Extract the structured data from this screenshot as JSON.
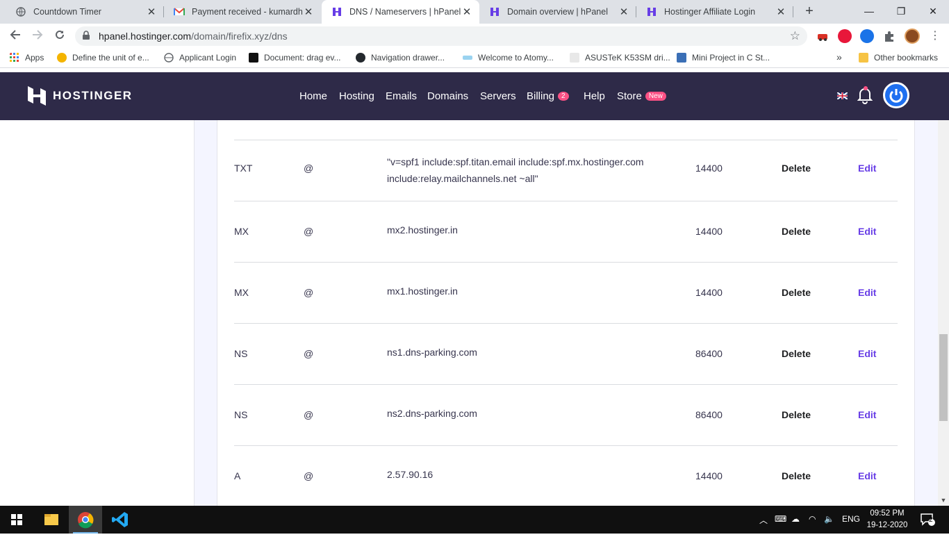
{
  "browser": {
    "tabs": [
      {
        "title": "Countdown Timer",
        "icon": "globe-icon"
      },
      {
        "title": "Payment received - kumardhira",
        "icon": "gmail-icon"
      },
      {
        "title": "DNS / Nameservers | hPanel",
        "icon": "hostinger-icon",
        "active": true
      },
      {
        "title": "Domain overview | hPanel",
        "icon": "hostinger-icon"
      },
      {
        "title": "Hostinger Affiliate Login",
        "icon": "hostinger-icon"
      }
    ],
    "url_host": "hpanel.hostinger.com",
    "url_path": "/domain/firefix.xyz/dns",
    "bookmarks": [
      {
        "label": "Apps",
        "icon": "apps-grid-icon"
      },
      {
        "label": "Define the unit of e...",
        "icon": "bulb-icon"
      },
      {
        "label": "Applicant Login",
        "icon": "globe-icon"
      },
      {
        "label": "Document: drag ev...",
        "icon": "document-icon"
      },
      {
        "label": "Navigation drawer...",
        "icon": "github-icon"
      },
      {
        "label": "Welcome to Atomy...",
        "icon": "atomy-icon"
      },
      {
        "label": "ASUSTeK K53SM dri...",
        "icon": "asus-icon"
      },
      {
        "label": "Mini Project in C St...",
        "icon": "user-icon"
      }
    ],
    "other_bookmarks": "Other bookmarks",
    "more_bookmarks": "»"
  },
  "header": {
    "brand": "HOSTINGER",
    "nav": [
      {
        "label": "Home"
      },
      {
        "label": "Hosting"
      },
      {
        "label": "Emails"
      },
      {
        "label": "Domains"
      },
      {
        "label": "Servers"
      },
      {
        "label": "Billing",
        "badge": "2"
      },
      {
        "label": "Help"
      },
      {
        "label": "Store",
        "badge": "New"
      }
    ]
  },
  "dns_records": [
    {
      "type": "TXT",
      "name": "@",
      "content": "\"v=spf1 include:spf.titan.email include:spf.mx.hostinger.com include:relay.mailchannels.net ~all\"",
      "ttl": "14400",
      "delete": "Delete",
      "edit": "Edit"
    },
    {
      "type": "MX",
      "name": "@",
      "content": "mx2.hostinger.in",
      "ttl": "14400",
      "delete": "Delete",
      "edit": "Edit"
    },
    {
      "type": "MX",
      "name": "@",
      "content": "mx1.hostinger.in",
      "ttl": "14400",
      "delete": "Delete",
      "edit": "Edit"
    },
    {
      "type": "NS",
      "name": "@",
      "content": "ns1.dns-parking.com",
      "ttl": "86400",
      "delete": "Delete",
      "edit": "Edit"
    },
    {
      "type": "NS",
      "name": "@",
      "content": "ns2.dns-parking.com",
      "ttl": "86400",
      "delete": "Delete",
      "edit": "Edit"
    },
    {
      "type": "A",
      "name": "@",
      "content": "2.57.90.16",
      "ttl": "14400",
      "delete": "Delete",
      "edit": "Edit"
    }
  ],
  "taskbar": {
    "language": "ENG",
    "time": "09:52 PM",
    "date": "19-12-2020",
    "notifications": "2"
  },
  "colors": {
    "header_bg": "#2e2a48",
    "accent": "#673de6",
    "badge": "#fc5185"
  }
}
